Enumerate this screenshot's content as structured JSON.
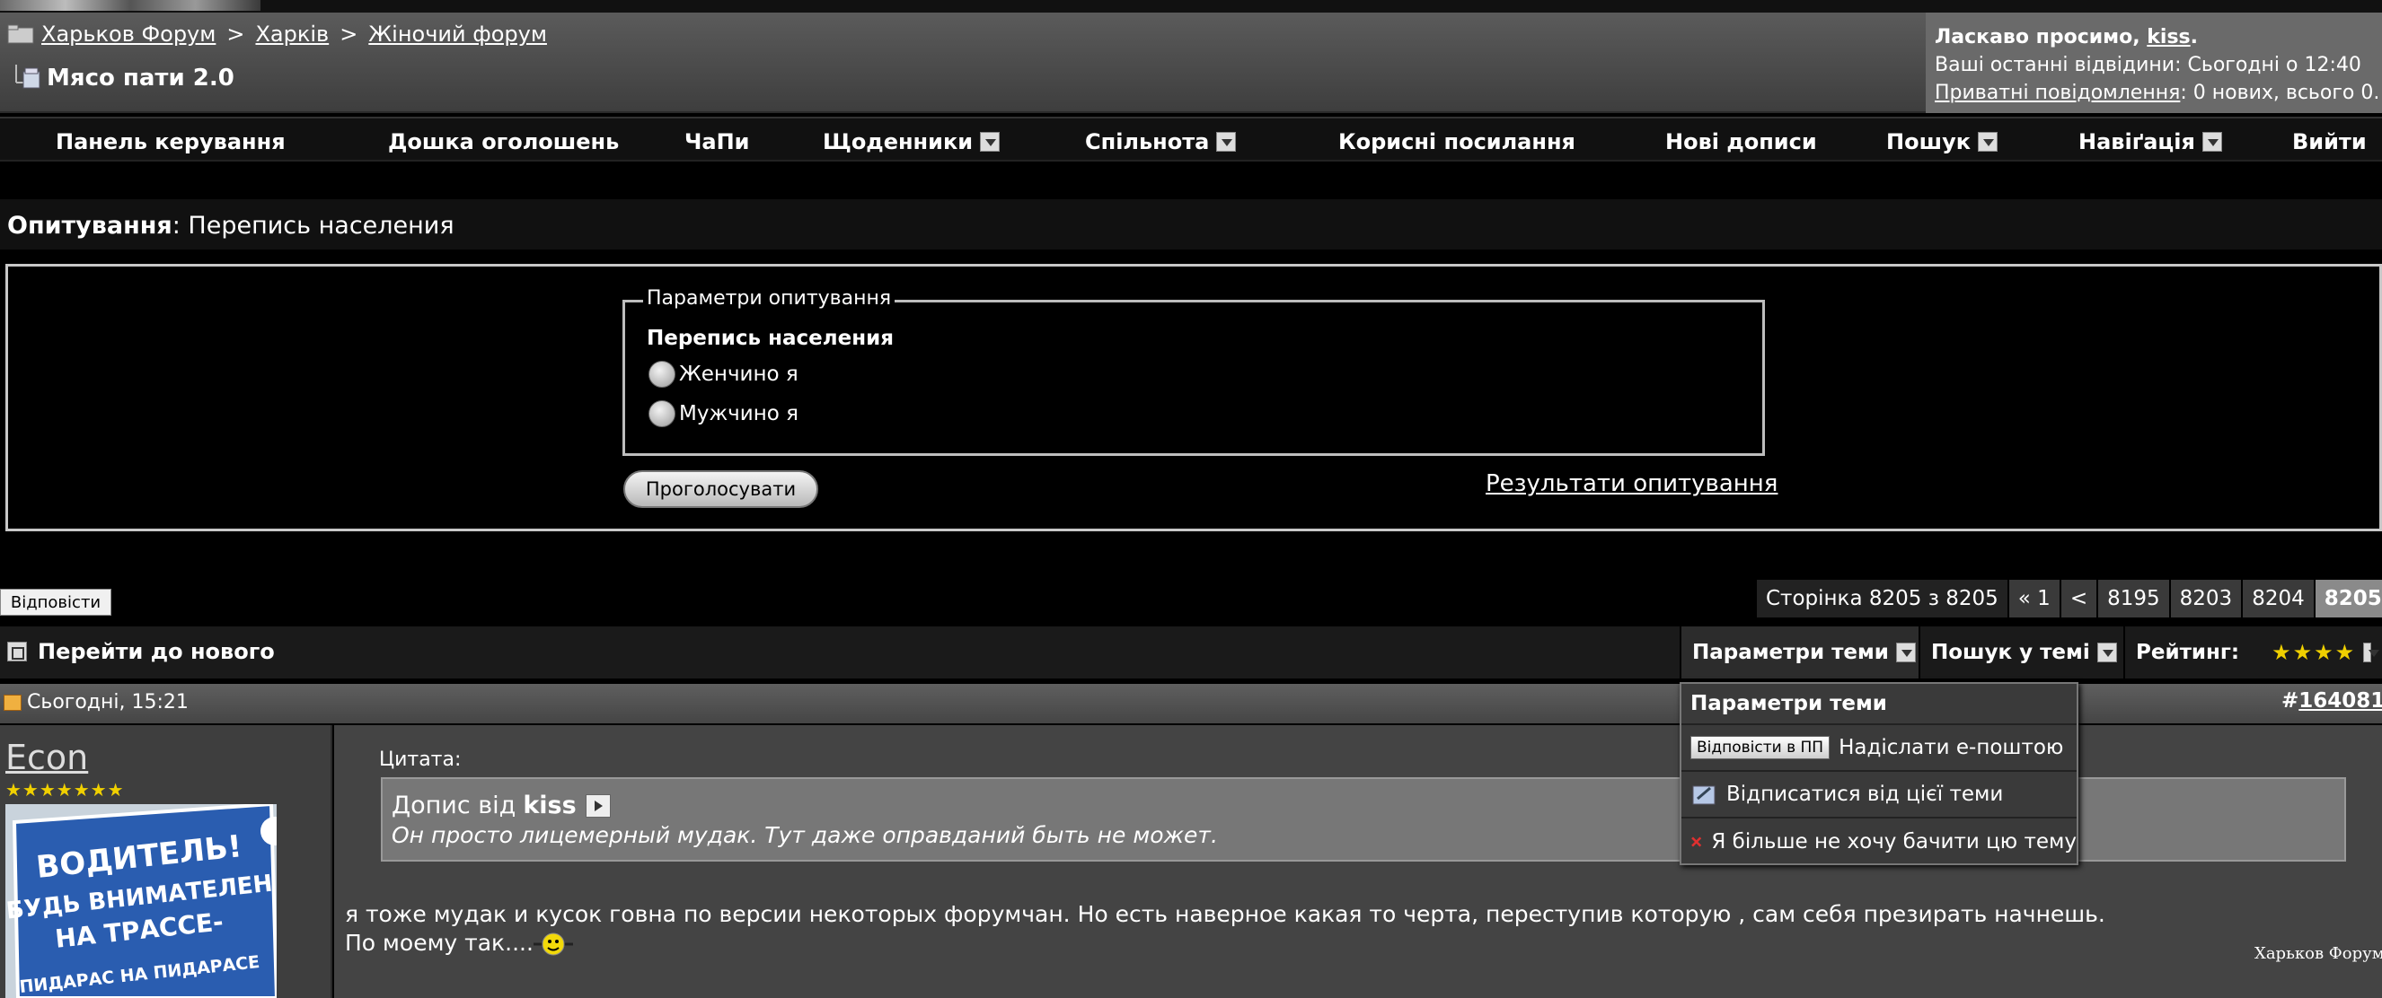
{
  "breadcrumb": {
    "items": [
      "Харьков Форум",
      "Харків",
      "Жіночий форум"
    ],
    "separator": ">"
  },
  "thread": {
    "title": "Мясо пати 2.0"
  },
  "welcome": {
    "greeting": "Ласкаво просимо, ",
    "username": "kiss",
    "greeting_end": ".",
    "last_visit": "Ваші останні відвідини: Сьогодні о 12:40",
    "pm_link": "Приватні повідомлення",
    "pm_status": ": 0 нових, всього 0."
  },
  "navbar": {
    "items": [
      {
        "label": "Панель керування",
        "icon": ""
      },
      {
        "label": "Дошка оголошень",
        "icon": ""
      },
      {
        "label": "ЧаПи",
        "icon": ""
      },
      {
        "label": "Щоденники",
        "icon": "menu-arrow-icon"
      },
      {
        "label": "Спільнота",
        "icon": "menu-arrow-icon"
      },
      {
        "label": "Корисні посилання",
        "icon": ""
      },
      {
        "label": "Нові дописи",
        "icon": ""
      },
      {
        "label": "Пошук",
        "icon": "menu-arrow-icon"
      },
      {
        "label": "Навіґація",
        "icon": "menu-arrow-icon"
      },
      {
        "label": "Вийти",
        "icon": ""
      }
    ]
  },
  "poll": {
    "heading_label": "Опитування",
    "heading_sep": ": ",
    "heading_title": "Перепись населения",
    "legend": "Параметри опитування",
    "question": "Перепись населения",
    "options": [
      "Женчино я",
      "Мужчино я"
    ],
    "vote_label": "Проголосувати",
    "results_link": "Результати опитування"
  },
  "reply_label": "Відповісти",
  "pagination": {
    "label": "Сторінка 8205 з 8205",
    "first": "« 1",
    "prev": "<",
    "pages": [
      "8195",
      "8203",
      "8204"
    ],
    "current": "8205"
  },
  "tools": {
    "goto_new": "Перейти до нового",
    "thread_tools": "Параметри теми",
    "search_thread": "Пошук у темі",
    "rating_label": "Рейтинг:",
    "rating_stars": "★★★★",
    "rating_value": 4
  },
  "dropdown": {
    "title": "Параметри теми",
    "reply_pm_btn": "Відповісти в ПП",
    "email": "Надіслати е-поштою",
    "unsubscribe": "Відписатися від цієї теми",
    "ignore": "Я більше не хочу бачити цю тему"
  },
  "post": {
    "date": "Сьогодні, 15:21",
    "number_prefix": "#",
    "number": "164081",
    "username": "Econ",
    "user_stars": "★★★★★★★",
    "quote_label": "Цитата:",
    "quote_author_prefix": "Допис від",
    "quote_author": "kiss",
    "quote_text": "Он просто лицемерный мудак. Тут даже оправданий быть не может.",
    "line1": "я тоже мудак и кусок говна по версии некоторых форумчан. Но есть наверное какая то черта, переступив которую , сам себя презирать начнешь.",
    "line2": "По моему так....",
    "avatar_lines": [
      "ВОДИТЕЛЬ!",
      "БУДЬ ВНИМАТЕЛЕН",
      "НА ТРАССЕ-",
      "ПИДАРАС НА ПИДАРАСЕ"
    ]
  },
  "watermark": "Харьков Форум",
  "colors": {
    "accent_stars": "#f0d000",
    "header_bg": "#4a4a4a",
    "welcome_bg": "#6a6a6a"
  }
}
